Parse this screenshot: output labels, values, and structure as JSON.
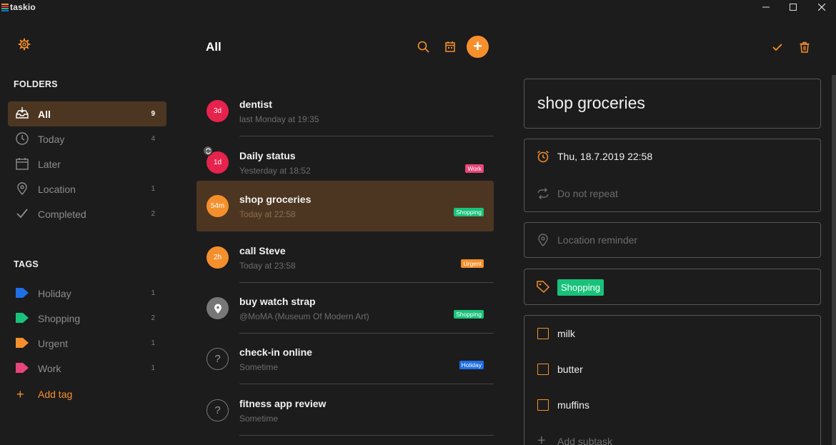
{
  "app": {
    "title": "taskio"
  },
  "colors": {
    "accent": "#f7902c",
    "selected_bg": "#4d3621",
    "urgent_red": "#e6234c"
  },
  "sidebar": {
    "folders_title": "FOLDERS",
    "folders": [
      {
        "label": "All",
        "count": "9",
        "icon": "inbox-icon",
        "active": true
      },
      {
        "label": "Today",
        "count": "4",
        "icon": "clock-icon"
      },
      {
        "label": "Later",
        "count": "",
        "icon": "calendar-icon"
      },
      {
        "label": "Location",
        "count": "1",
        "icon": "location-pin-icon"
      },
      {
        "label": "Completed",
        "count": "2",
        "icon": "checkmark-icon"
      }
    ],
    "tags_title": "TAGS",
    "tags": [
      {
        "label": "Holiday",
        "count": "1",
        "color": "#1f6fe5"
      },
      {
        "label": "Shopping",
        "count": "2",
        "color": "#19c27a"
      },
      {
        "label": "Urgent",
        "count": "1",
        "color": "#f48f2d"
      },
      {
        "label": "Work",
        "count": "1",
        "color": "#e8457a"
      }
    ],
    "add_tag_label": "Add tag",
    "add_tag_plus": "+"
  },
  "main": {
    "title": "All",
    "add_button_label": "+",
    "tasks": [
      {
        "title": "dentist",
        "subtitle": "last Monday at 19:35",
        "badge": "3d",
        "badge_color": "red"
      },
      {
        "title": "Daily status",
        "subtitle": "Yesterday at 18:52",
        "badge": "1d",
        "badge_color": "red",
        "repeat": true,
        "tag": "Work",
        "tag_color": "#e8457a"
      },
      {
        "title": "shop groceries",
        "subtitle": "Today at 22:58",
        "badge": "54m",
        "badge_color": "orange",
        "selected": true,
        "tag": "Shopping",
        "tag_color": "#19c27a"
      },
      {
        "title": "call Steve",
        "subtitle": "Today at 23:58",
        "badge": "2h",
        "badge_color": "orange",
        "tag": "Urgent",
        "tag_color": "#f48f2d"
      },
      {
        "title": "buy watch strap",
        "subtitle": "@MoMA (Museum Of Modern Art)",
        "badge_icon": "location-pin-icon",
        "badge_color": "gray",
        "tag": "Shopping",
        "tag_color": "#19c27a"
      },
      {
        "title": "check-in online",
        "subtitle": "Sometime",
        "badge": "?",
        "badge_color": "outline",
        "tag": "Holiday",
        "tag_color": "#1f6fe5"
      },
      {
        "title": "fitness app review",
        "subtitle": "Sometime",
        "badge": "?",
        "badge_color": "outline"
      }
    ]
  },
  "detail": {
    "title": "shop groceries",
    "date": "Thu, 18.7.2019 22:58",
    "repeat": "Do not repeat",
    "location_placeholder": "Location reminder",
    "tag": "Shopping",
    "subtasks": [
      "milk",
      "butter",
      "muffins"
    ],
    "add_subtask_label": "Add subtask",
    "add_subtask_plus": "+"
  }
}
